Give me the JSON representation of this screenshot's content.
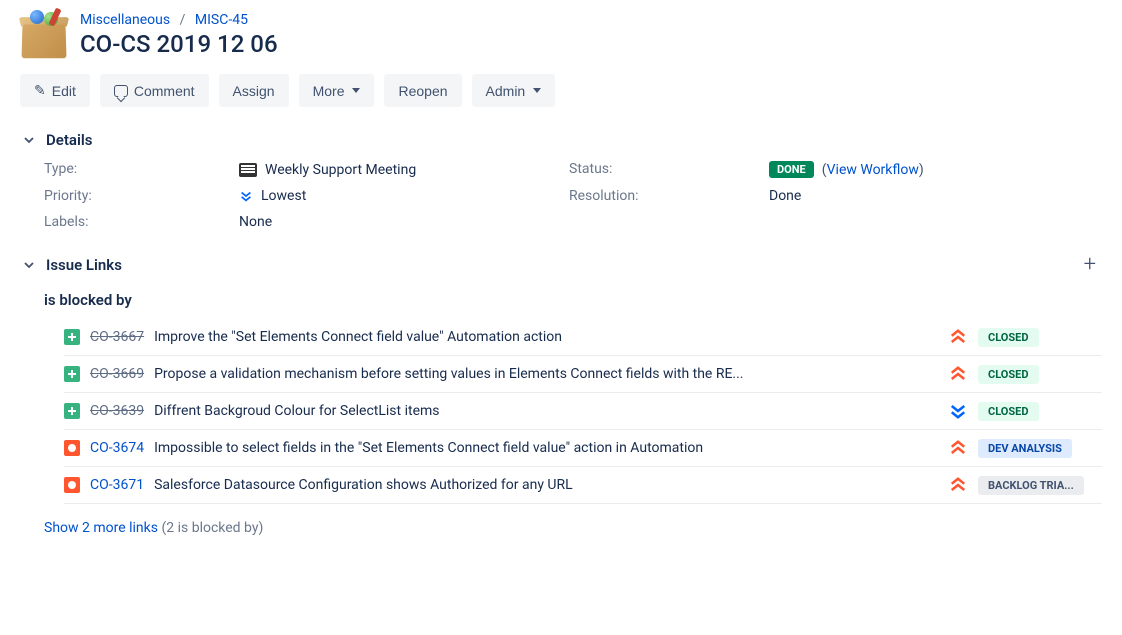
{
  "breadcrumb": {
    "project": "Miscellaneous",
    "key": "MISC-45"
  },
  "title": "CO-CS 2019 12 06",
  "toolbar": {
    "edit": "Edit",
    "comment": "Comment",
    "assign": "Assign",
    "more": "More",
    "reopen": "Reopen",
    "admin": "Admin"
  },
  "sections": {
    "details": "Details",
    "issue_links": "Issue Links"
  },
  "details": {
    "type_label": "Type:",
    "type_value": "Weekly Support Meeting",
    "priority_label": "Priority:",
    "priority_value": "Lowest",
    "labels_label": "Labels:",
    "labels_value": "None",
    "status_label": "Status:",
    "status_value": "DONE",
    "view_workflow": "View Workflow",
    "resolution_label": "Resolution:",
    "resolution_value": "Done"
  },
  "links": {
    "group_title": "is blocked by",
    "items": [
      {
        "key": "CO-3667",
        "summary": "Improve the \"Set Elements Connect field value\" Automation action",
        "type": "improvement",
        "resolved": true,
        "priority": "high",
        "status": "CLOSED",
        "status_class": "closed"
      },
      {
        "key": "CO-3669",
        "summary": "Propose a validation mechanism before setting values in Elements Connect fields with the RE...",
        "type": "improvement",
        "resolved": true,
        "priority": "high",
        "status": "CLOSED",
        "status_class": "closed"
      },
      {
        "key": "CO-3639",
        "summary": "Diffrent Backgroud Colour for SelectList items",
        "type": "improvement",
        "resolved": true,
        "priority": "low",
        "status": "CLOSED",
        "status_class": "closed"
      },
      {
        "key": "CO-3674",
        "summary": "Impossible to select fields in the \"Set Elements Connect field value\" action in Automation",
        "type": "bug",
        "resolved": false,
        "priority": "high",
        "status": "DEV ANALYSIS",
        "status_class": "blue"
      },
      {
        "key": "CO-3671",
        "summary": "Salesforce Datasource Configuration shows Authorized for any URL",
        "type": "bug",
        "resolved": false,
        "priority": "high",
        "status": "BACKLOG TRIA...",
        "status_class": "gray"
      }
    ],
    "show_more": "Show 2 more links",
    "show_more_detail": "(2 is blocked by)"
  }
}
